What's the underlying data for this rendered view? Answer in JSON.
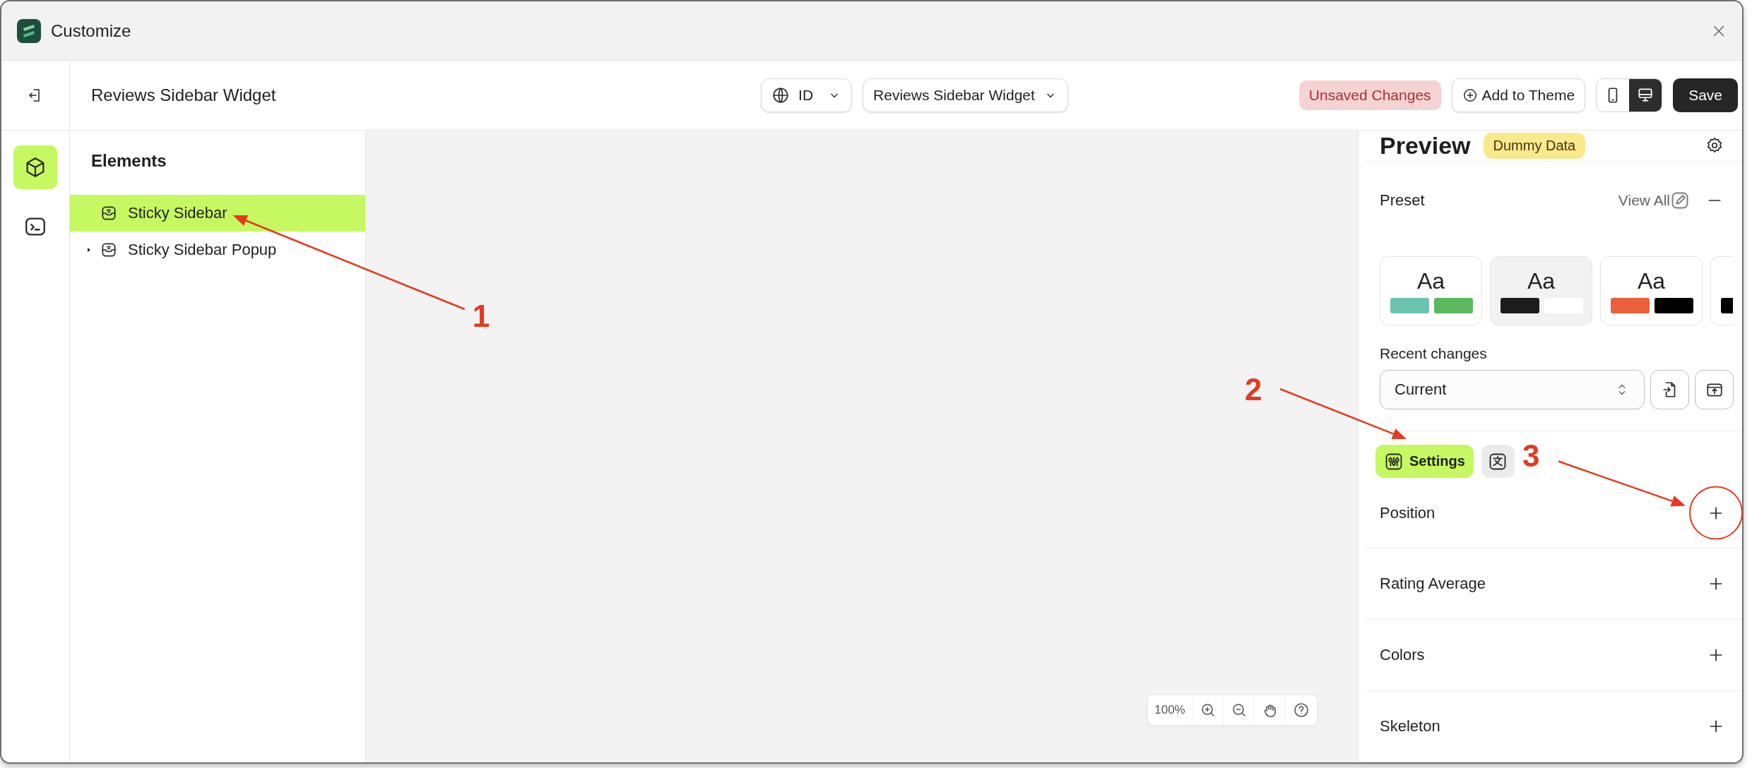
{
  "window": {
    "title": "Customize"
  },
  "header": {
    "title": "Reviews Sidebar Widget",
    "language": "ID",
    "template": "Reviews Sidebar Widget",
    "status_badge": "Unsaved Changes",
    "add_button": "Add to Theme",
    "devices": [
      {
        "kind": "mobile",
        "selected": false
      },
      {
        "kind": "desktop",
        "selected": true
      }
    ],
    "save_button": "Save"
  },
  "rail": [
    {
      "kind": "elements",
      "selected": true
    },
    {
      "kind": "code",
      "selected": false
    }
  ],
  "elements_panel": {
    "title": "Elements",
    "items": [
      {
        "label": "Sticky Sidebar",
        "selected": true,
        "has_children": false
      },
      {
        "label": "Sticky Sidebar Popup",
        "selected": false,
        "has_children": true
      }
    ]
  },
  "canvas": {
    "zoom_level": "100%",
    "tools": [
      {
        "kind": "zoom-in"
      },
      {
        "kind": "zoom-out"
      },
      {
        "kind": "pan"
      },
      {
        "kind": "help"
      }
    ]
  },
  "preview": {
    "title": "Preview",
    "badge": "Dummy Data",
    "preset": {
      "title": "Preset",
      "view_all": "View All",
      "expanded": true,
      "presets": [
        {
          "sample": "Aa",
          "swatches": [
            {
              "color": "#6cc3b0"
            },
            {
              "color": "#5cb85c"
            }
          ],
          "selected": false
        },
        {
          "sample": "Aa",
          "swatches": [
            {
              "color": "#1c1c1c"
            },
            {
              "color": "#ffffff"
            }
          ],
          "selected": true
        },
        {
          "sample": "Aa",
          "swatches": [
            {
              "color": "#e9603a"
            },
            {
              "color": "#000000"
            }
          ],
          "selected": false
        },
        {
          "swatches": [
            {
              "color": "#000000"
            }
          ],
          "selected": false
        }
      ]
    },
    "recent_changes": {
      "label": "Recent changes",
      "value": "Current",
      "actions": [
        {
          "kind": "import"
        },
        {
          "kind": "export"
        }
      ]
    },
    "tabs": [
      {
        "kind": "settings",
        "label": "Settings",
        "selected": true
      },
      {
        "kind": "translate",
        "selected": false
      }
    ],
    "sections": [
      {
        "title": "Position",
        "expanded": false
      },
      {
        "title": "Rating Average",
        "expanded": false
      },
      {
        "title": "Colors",
        "expanded": false
      },
      {
        "title": "Skeleton",
        "expanded": false
      }
    ]
  },
  "annotations": [
    {
      "label": "1",
      "kind": "arrow"
    },
    {
      "label": "2",
      "kind": "arrow"
    },
    {
      "label": "3",
      "kind": "arrow-circle"
    }
  ]
}
